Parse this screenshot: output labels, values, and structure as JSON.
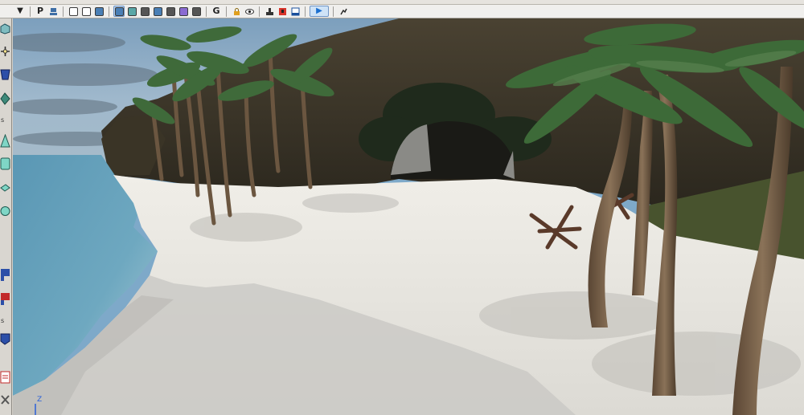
{
  "toolbar": {
    "dropdown_arrow": "▼",
    "persp_label": "P",
    "group_label": "G",
    "play_glyph": "▶",
    "icons": [
      "dropdown-arrow",
      "perspective-button",
      "camera-icon",
      "wire-cube-icon",
      "smooth-cube-icon",
      "shaded-cube-icon",
      "textured-cube-icon",
      "lit-cube-icon",
      "shadow-cube-icon",
      "xray-cube-icon",
      "isolate-icon",
      "bounding-box-icon",
      "grid-icon",
      "group-button",
      "lock-icon",
      "eye-icon",
      "render-icon",
      "render-region-icon",
      "frame-icon",
      "play-button",
      "snapshot-icon"
    ]
  },
  "sidebar": {
    "label_s1": "s",
    "label_s2": "s",
    "tools": [
      "select-cube-icon",
      "move-tool-icon",
      "scale-tool-icon",
      "sculpt-brush-icon",
      "cone-tool-icon",
      "extrude-tool-icon",
      "plane-tool-icon",
      "sphere-tool-icon",
      "align-tool-icon",
      "snap-tool-icon",
      "bevel-tool-icon",
      "script-editor-icon",
      "settings-tool-icon"
    ]
  },
  "viewport": {
    "axis": {
      "z_label": "Z"
    },
    "scene": "tropical-beach-3d-render"
  },
  "colors": {
    "sky": "#8fb3cf",
    "water": "#5e9ab8",
    "sand": "#e4e2dc",
    "rock": "#3a3428",
    "palm_leaf": "#3f6a3a",
    "trunk": "#6b5640",
    "accent": "#1b6fd0"
  }
}
